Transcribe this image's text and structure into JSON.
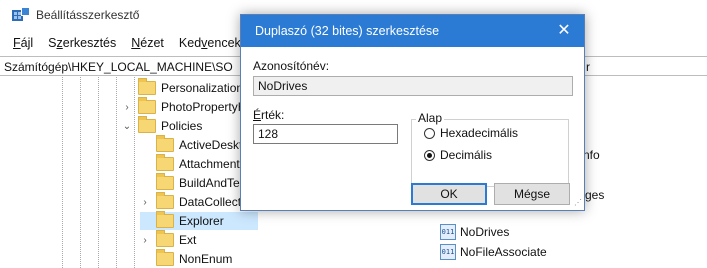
{
  "main": {
    "title": "Beállításszerkesztő",
    "menu": [
      {
        "prefix": "",
        "accel": "F",
        "rest": "ájl"
      },
      {
        "prefix": "S",
        "accel": "z",
        "rest": "erkesztés"
      },
      {
        "prefix": "",
        "accel": "N",
        "rest": "ézet"
      },
      {
        "prefix": "Ked",
        "accel": "v",
        "rest": "encek"
      }
    ],
    "address": "Számítógép\\HKEY_LOCAL_MACHINE\\SO",
    "address_tail": "r",
    "tree": [
      {
        "label": "Personalization",
        "expander": ""
      },
      {
        "label": "PhotoPropertyH",
        "expander": "›"
      },
      {
        "label": "Policies",
        "expander": "⌄"
      },
      {
        "label": "ActiveDeskto",
        "expander": ""
      },
      {
        "label": "Attachments",
        "expander": ""
      },
      {
        "label": "BuildAndTel",
        "expander": ""
      },
      {
        "label": "DataCollectio",
        "expander": "›"
      },
      {
        "label": "Explorer",
        "expander": ""
      },
      {
        "label": "Ext",
        "expander": "›"
      },
      {
        "label": "NonEnum",
        "expander": ""
      }
    ],
    "right_partials": [
      "nfo",
      "ges"
    ],
    "values": [
      {
        "label": "NoDrives",
        "icon": "011"
      },
      {
        "label": "NoFileAssociate",
        "icon": "011"
      }
    ]
  },
  "dialog": {
    "title": "Duplaszó (32 bites) szerkesztése",
    "close": "✕",
    "name_label": "Azonosítónév:",
    "name_value": "NoDrives",
    "value_label_accel": "É",
    "value_label_rest": "rték:",
    "value_value": "128",
    "base_group": "Alap",
    "radio_hex": "Hexadecimális",
    "radio_dec": "Decimális",
    "ok": "OK",
    "cancel": "Mégse",
    "selected_base": "Decimális"
  }
}
